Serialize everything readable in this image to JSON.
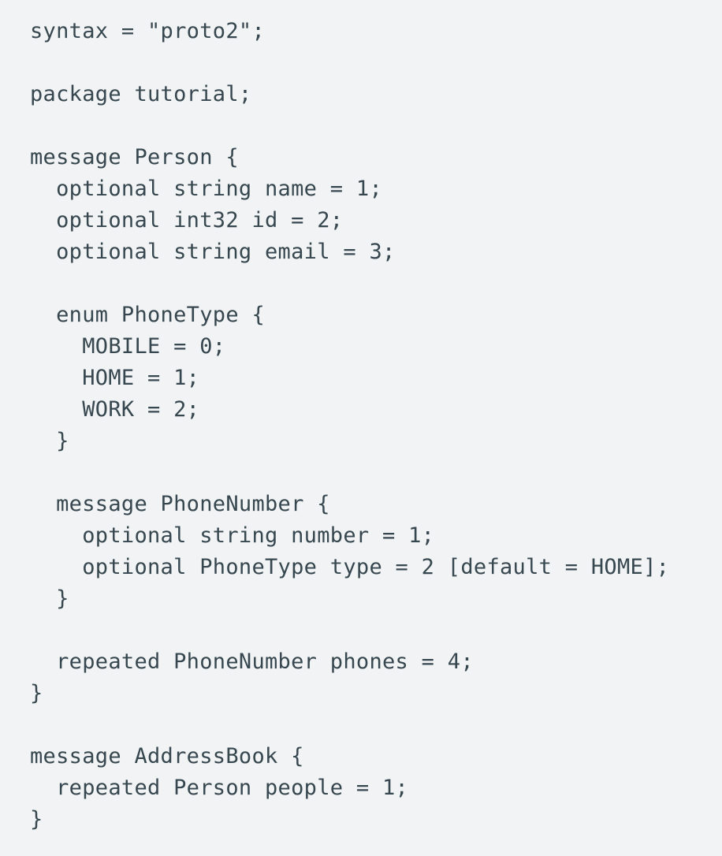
{
  "code": {
    "lines": [
      "syntax = \"proto2\";",
      "",
      "package tutorial;",
      "",
      "message Person {",
      "  optional string name = 1;",
      "  optional int32 id = 2;",
      "  optional string email = 3;",
      "",
      "  enum PhoneType {",
      "    MOBILE = 0;",
      "    HOME = 1;",
      "    WORK = 2;",
      "  }",
      "",
      "  message PhoneNumber {",
      "    optional string number = 1;",
      "    optional PhoneType type = 2 [default = HOME];",
      "  }",
      "",
      "  repeated PhoneNumber phones = 4;",
      "}",
      "",
      "message AddressBook {",
      "  repeated Person people = 1;",
      "}"
    ]
  },
  "colors": {
    "background": "#f1f3f4",
    "text": "#37474f"
  }
}
